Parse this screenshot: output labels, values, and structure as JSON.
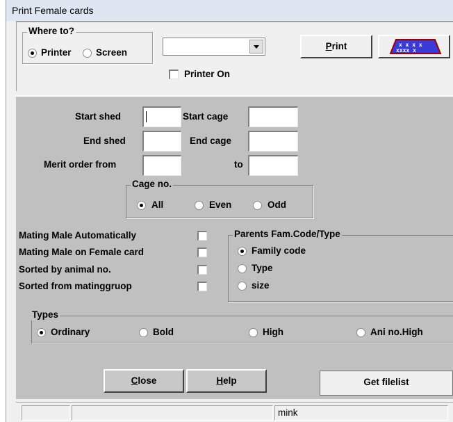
{
  "window": {
    "title": "Print Female cards"
  },
  "where_to": {
    "caption": "Where to?",
    "printer_label": "Printer",
    "screen_label": "Screen",
    "selected": "Printer"
  },
  "destination_select": {
    "value": ""
  },
  "printer_on": {
    "label": "Printer On",
    "checked": false
  },
  "print_button": {
    "accel": "P",
    "rest": "rint"
  },
  "image_button": {
    "icon": "printer-pattern-icon",
    "colors": {
      "fill": "#3a3ad8",
      "frame": "#a00000",
      "marks": "#ffffff"
    }
  },
  "range": {
    "start_shed_label": "Start shed",
    "end_shed_label": "End shed",
    "merit_from_label": "Merit order from",
    "start_cage_label": "Start cage",
    "end_cage_label": "End cage",
    "to_label": "to",
    "start_shed": "",
    "end_shed": "",
    "merit_from": "",
    "start_cage": "",
    "end_cage": "",
    "merit_to": ""
  },
  "cage_no": {
    "caption": "Cage no.",
    "all_label": "All",
    "even_label": "Even",
    "odd_label": "Odd",
    "selected": "All"
  },
  "options": [
    {
      "label": "Mating Male Automatically",
      "checked": false
    },
    {
      "label": "Mating Male on Female card",
      "checked": false
    },
    {
      "label": "Sorted by animal no.",
      "checked": false
    },
    {
      "label": "Sorted from matinggruop",
      "checked": false
    }
  ],
  "parents": {
    "caption": "Parents Fam.Code/Type",
    "family_code_label": "Family code",
    "type_label": "Type",
    "size_label": "size",
    "selected": "Family code"
  },
  "types": {
    "caption": "Types",
    "ordinary_label": "Ordinary",
    "bold_label": "Bold",
    "high_label": "High",
    "ani_high_label": "Ani no.High",
    "selected": "Ordinary"
  },
  "buttons": {
    "close_accel": "C",
    "close_rest": "lose",
    "help_accel": "H",
    "help_rest": "elp",
    "get_filelist": "Get filelist"
  },
  "status": {
    "pane1": "",
    "pane2": "",
    "pane3": "mink"
  }
}
